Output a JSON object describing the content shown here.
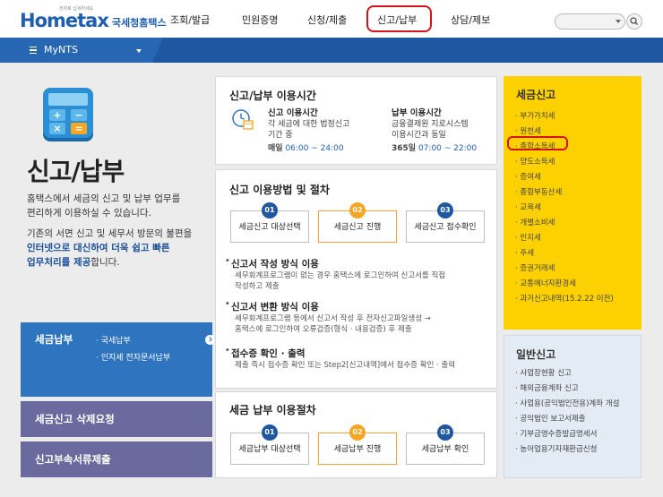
{
  "header": {
    "logo_text": "Hometax",
    "logo_tagline": "전자로 납세하세요",
    "logo_kr": "국세청홈택스",
    "nav": [
      "조회/발급",
      "민원증명",
      "신청/제출",
      "신고/납부",
      "상담/제보"
    ],
    "search_placeholder": ""
  },
  "bar": {
    "label": "MyNTS"
  },
  "left": {
    "title": "신고/납부",
    "desc1_l1": "홈택스에서 세금의 신고 및 납부 업무를",
    "desc1_l2": "편리하게 이용하실 수 있습니다.",
    "desc2_l1": "기존의 서면 신고 및 세무서 방문의 불편을",
    "desc2_l2a": "인터넷으로 대신하여 더욱 쉽고 빠른",
    "desc2_l3a": "업무처리를 제공",
    "desc2_l3b": "합니다.",
    "pay_title": "세금납부",
    "pay_sub1": "· 국세납부",
    "pay_sub2": "· 인지세 전자문서납부",
    "delete_request": "세금신고 삭제요청",
    "attach_submit": "신고부속서류제출"
  },
  "hours": {
    "title": "신고/납부 이용시간",
    "file_title": "신고 이용시간",
    "file_desc1": "각 세금에 대한 법정신고",
    "file_desc2": "기간 중",
    "file_daily": "매일",
    "file_time": "06:00 ~ 24:00",
    "pay_title": "납부 이용시간",
    "pay_desc1": "금융결제원 지로시스템",
    "pay_desc2": "이용시간과 동일",
    "pay_days": "365일",
    "pay_time": "07:00 ~ 22:00"
  },
  "filing": {
    "title": "신고 이용방법 및 절차",
    "steps": [
      {
        "num": "01",
        "label": "세금신고 대상선택"
      },
      {
        "num": "02",
        "label": "세금신고 진행"
      },
      {
        "num": "03",
        "label": "세금신고 접수확인"
      }
    ],
    "sec1_h": "신고서 작성 방식 이용",
    "sec1_d1": "세무회계프로그램이 없는 경우 홈택스에 로그인하여 신고서를 직접",
    "sec1_d2": "작성하고 제출",
    "sec2_h": "신고서 변환 방식 이용",
    "sec2_d1": "세무회계프로그램 등에서 신고서 작성 후 전자신고파일생성 →",
    "sec2_d2": "홈택스에 로그인하여 오류검증(형식 · 내용검증) 후 제출",
    "sec3_h": "접수증 확인 · 출력",
    "sec3_d1": "제출 즉시 접수증 확인 또는 Step2[신고내역]에서 접수증 확인 · 출력"
  },
  "payment": {
    "title": "세금 납부 이용절차",
    "steps": [
      {
        "num": "01",
        "label": "세금납부 대상선택"
      },
      {
        "num": "02",
        "label": "세금납부 진행"
      },
      {
        "num": "03",
        "label": "세금납부 확인"
      }
    ]
  },
  "tax_filing": {
    "title": "세금신고",
    "items": [
      "부가가치세",
      "원천세",
      "종합소득세",
      "양도소득세",
      "증여세",
      "종합부동산세",
      "교육세",
      "개별소비세",
      "인지세",
      "주세",
      "증권거래세",
      "교통에너지환경세",
      "과거신고내역(15.2.22 이전)"
    ]
  },
  "general_filing": {
    "title": "일반신고",
    "items": [
      "사업장현황 신고",
      "해외금융계좌 신고",
      "사업용(공익법인전용)계좌 개설",
      "공익법인 보고서제출",
      "기부금영수증발급명세서",
      "농어업용기자재환급신청"
    ]
  }
}
